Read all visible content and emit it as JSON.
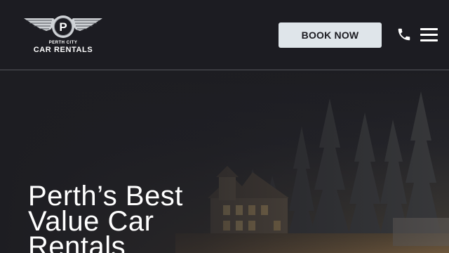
{
  "header": {
    "logo": {
      "small_text": "PERTH CITY",
      "big_text": "CAR RENTALS",
      "emblem_letter": "P"
    },
    "book_button_label": "BOOK NOW",
    "phone_icon": "phone-icon",
    "menu_icon": "hamburger-menu-icon"
  },
  "hero": {
    "title": "Perth’s Best Value Car Rentals"
  },
  "colors": {
    "header_bg": "#1c1c22",
    "button_bg": "#dfe5ea",
    "text_light": "#ffffff"
  }
}
